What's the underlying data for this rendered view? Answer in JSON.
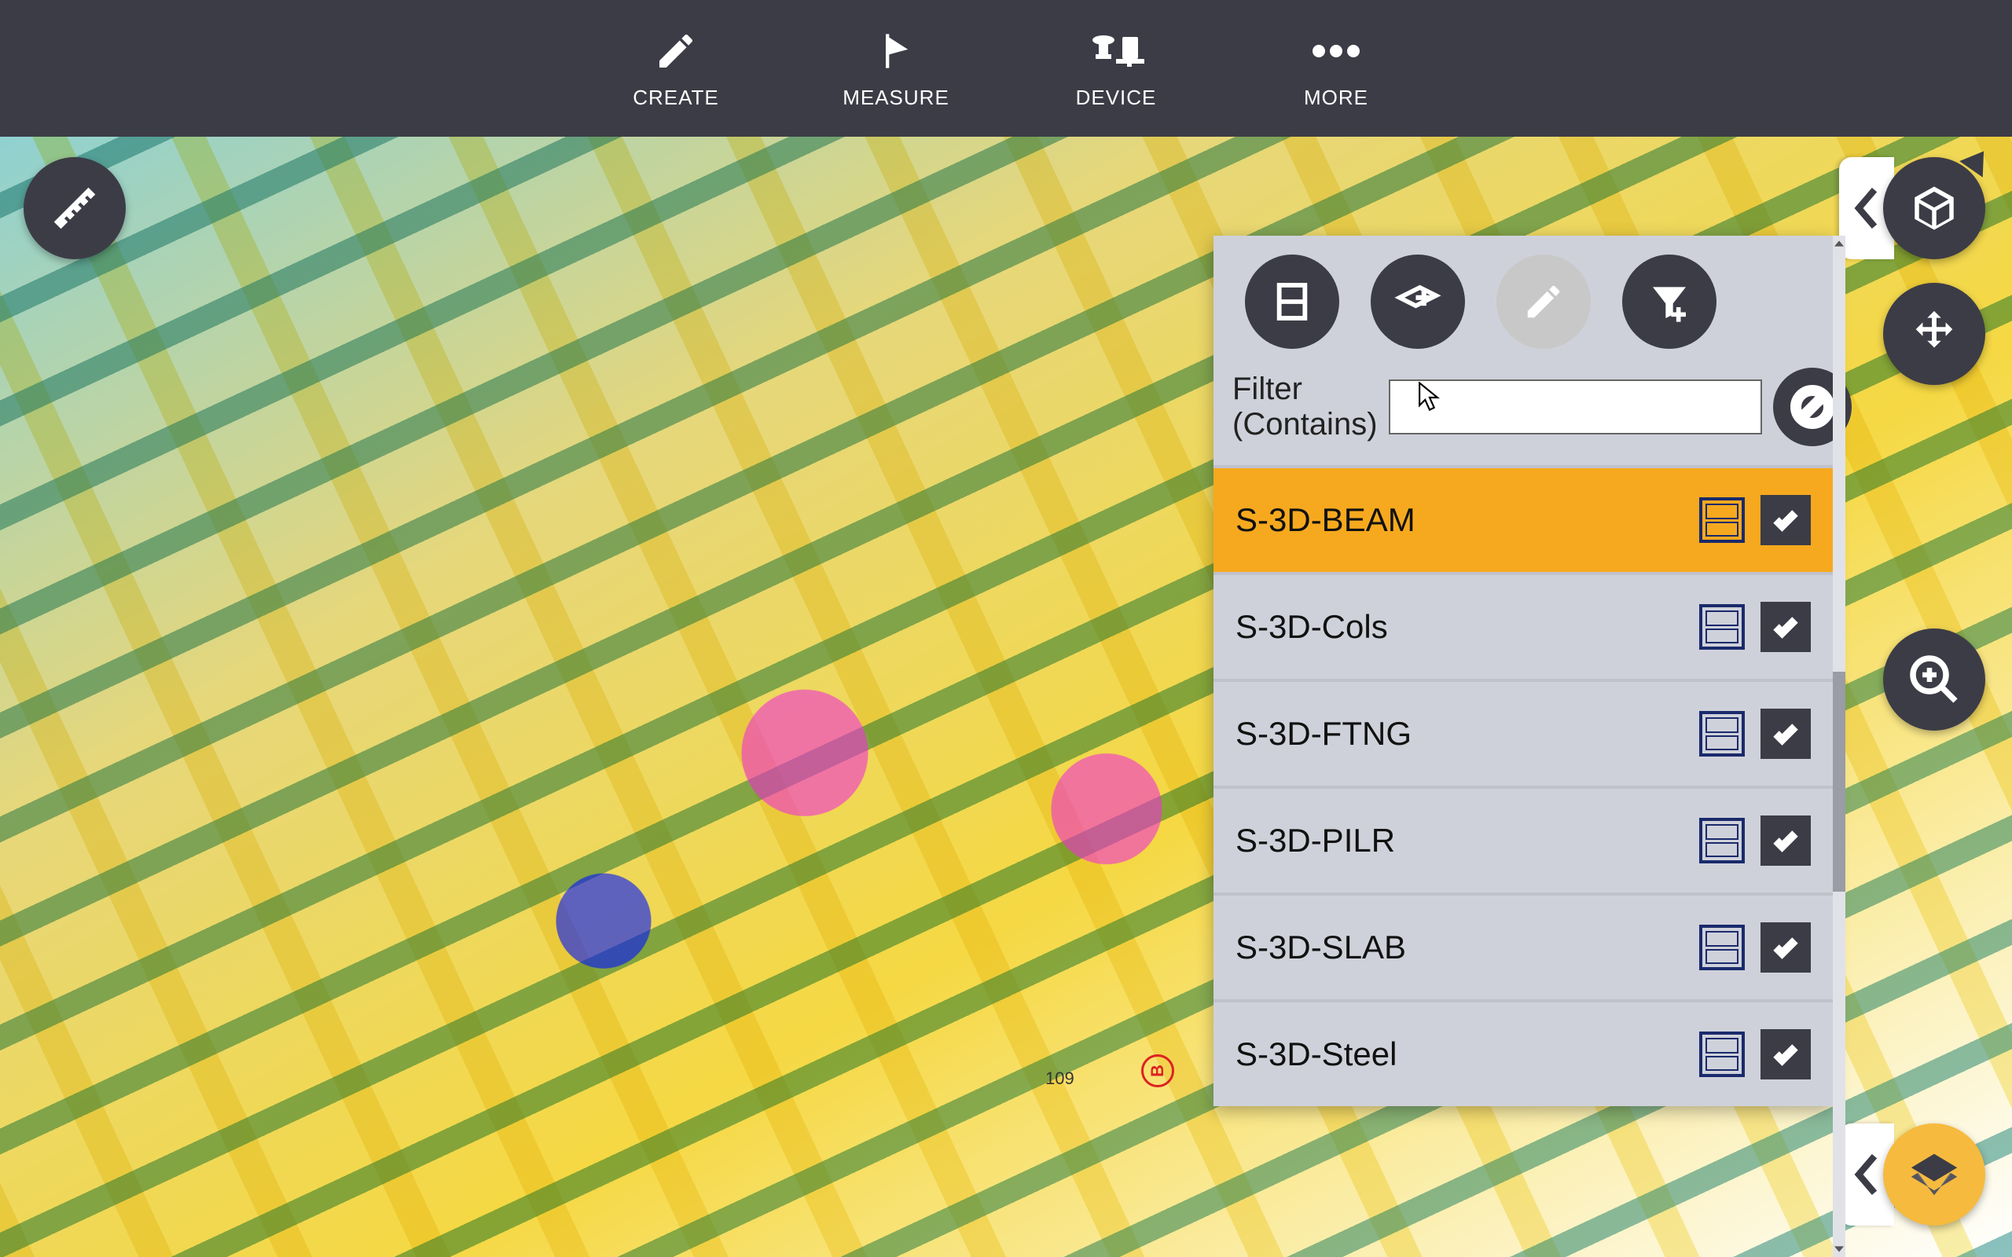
{
  "toolbar": {
    "create": "CREATE",
    "measure": "MEASURE",
    "device": "DEVICE",
    "more": "MORE"
  },
  "panel": {
    "filter_label": "Filter (Contains)",
    "filter_value": "",
    "items": [
      {
        "label": "S-3D-BEAM",
        "checked": true,
        "selected": true
      },
      {
        "label": "S-3D-Cols",
        "checked": true,
        "selected": false
      },
      {
        "label": "S-3D-FTNG",
        "checked": true,
        "selected": false
      },
      {
        "label": "S-3D-PILR",
        "checked": true,
        "selected": false
      },
      {
        "label": "S-3D-SLAB",
        "checked": true,
        "selected": false
      },
      {
        "label": "S-3D-Steel",
        "checked": true,
        "selected": false
      }
    ]
  },
  "viewport": {
    "annotation_b": "B",
    "annotation_109": "109"
  },
  "colors": {
    "accent": "#F6A91E",
    "dark": "#3C3C46",
    "panel": "#CFD1DA"
  }
}
